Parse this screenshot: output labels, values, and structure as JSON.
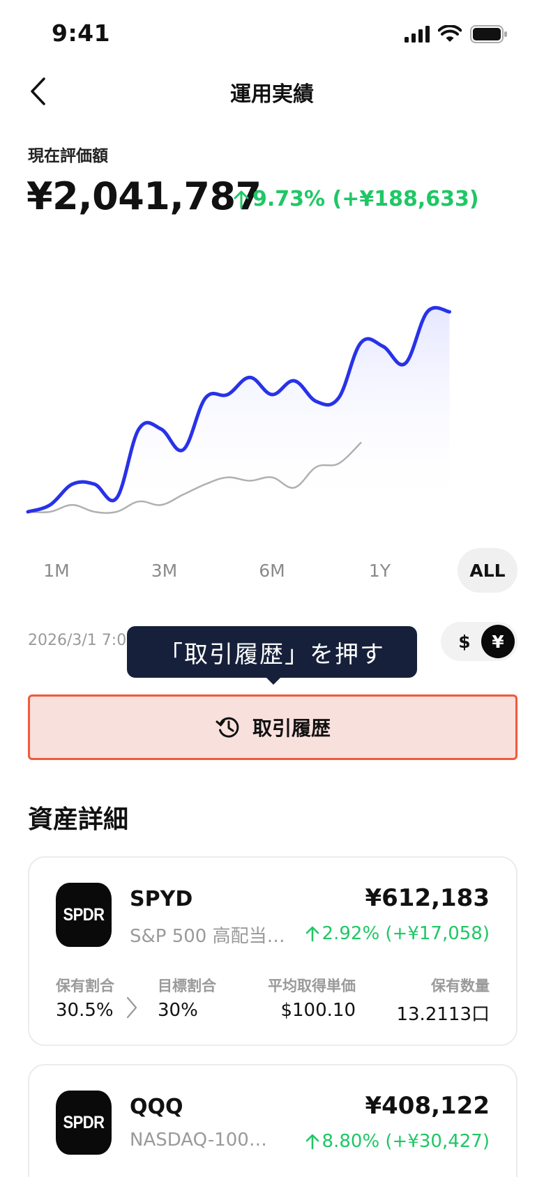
{
  "status": {
    "time": "9:41"
  },
  "nav": {
    "title": "運用実績"
  },
  "valuation": {
    "label": "現在評価額",
    "amount": "¥2,041,787",
    "change": "9.73% (+¥188,633)",
    "change_color": "#1fc765"
  },
  "chart_data": {
    "type": "line",
    "x": [
      0,
      1,
      2,
      3,
      4,
      5,
      6,
      7,
      8,
      9,
      10,
      11,
      12,
      13,
      14,
      15,
      16,
      17,
      18,
      19,
      20,
      21,
      22
    ],
    "series": [
      {
        "color": "#2832e8",
        "values": [
          0,
          2,
          8,
          8,
          4,
          24,
          24,
          18,
          33,
          34,
          39,
          34,
          38,
          32,
          33,
          49,
          48,
          43,
          58,
          58
        ]
      },
      {
        "color": "#b0b0b0",
        "values": [
          0,
          0,
          2,
          0,
          0,
          3,
          2,
          5,
          8,
          10,
          9,
          10,
          7,
          13,
          14,
          20
        ]
      }
    ],
    "area_fill": "#eceeff",
    "grid": false,
    "legend": "none"
  },
  "ranges": {
    "items": [
      "1M",
      "3M",
      "6M",
      "1Y",
      "ALL"
    ],
    "active": "ALL"
  },
  "as_of": "2026/3/1 7:0",
  "currency": {
    "usd": "$",
    "jpy": "¥",
    "active": "jpy"
  },
  "tooltip": {
    "text": "「取引履歴」を押す"
  },
  "history": {
    "label": "取引履歴",
    "icon": "history-icon"
  },
  "assets": {
    "title": "資産詳細",
    "labels": {
      "holding_ratio": "保有割合",
      "target_ratio": "目標割合",
      "avg_price": "平均取得単価",
      "quantity": "保有数量"
    },
    "items": [
      {
        "logo": "SPDR",
        "ticker": "SPYD",
        "name": "S&P 500 高配当…",
        "value": "¥612,183",
        "change": "2.92% (+¥17,058)",
        "holding_ratio": "30.5%",
        "target_ratio": "30%",
        "avg_price": "$100.10",
        "quantity": "13.2113口"
      },
      {
        "logo": "SPDR",
        "ticker": "QQQ",
        "name": "NASDAQ-100…",
        "value": "¥408,122",
        "change": "8.80% (+¥30,427)"
      }
    ]
  },
  "colors": {
    "accent_blue": "#2832e8",
    "positive_green": "#1fc765",
    "highlight_red": "#ef5a3c",
    "tooltip_bg": "#16203a"
  }
}
